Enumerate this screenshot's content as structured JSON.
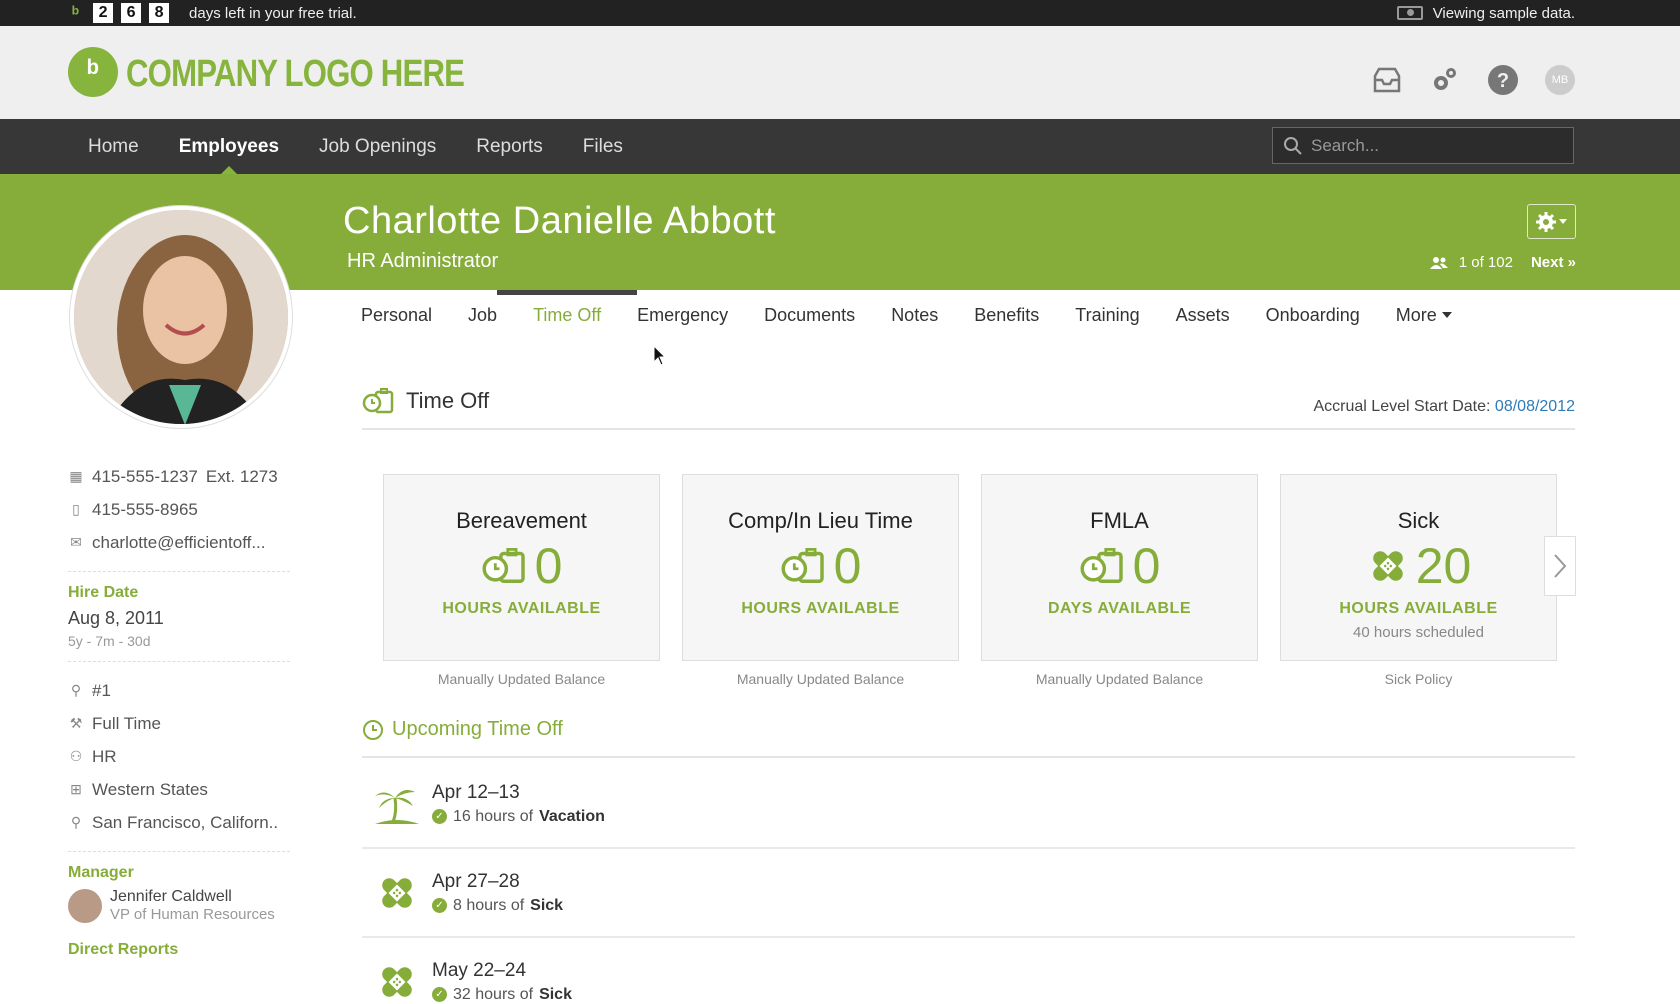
{
  "trial": {
    "digits": [
      "2",
      "6",
      "8"
    ],
    "text": "days left in your free trial.",
    "sample_text": "Viewing sample data."
  },
  "header": {
    "logo_text": "COMPANY LOGO HERE",
    "avatar_initials": "MB"
  },
  "nav": {
    "items": [
      {
        "label": "Home"
      },
      {
        "label": "Employees"
      },
      {
        "label": "Job Openings"
      },
      {
        "label": "Reports"
      },
      {
        "label": "Files"
      }
    ],
    "active": "Employees",
    "search_placeholder": "Search..."
  },
  "employee": {
    "name": "Charlotte Danielle Abbott",
    "title": "HR Administrator",
    "pager": "1 of 102",
    "next": "Next »",
    "work_phone": "415-555-1237",
    "work_ext": "Ext. 1273",
    "mobile": "415-555-8965",
    "email": "charlotte@efficientoff...",
    "hire_date_label": "Hire Date",
    "hire_date": "Aug 8, 2011",
    "tenure": "5y - 7m - 30d",
    "employee_number": "#1",
    "employment_type": "Full Time",
    "department": "HR",
    "division": "Western States",
    "location": "San Francisco, Californ..",
    "manager_label": "Manager",
    "manager_name": "Jennifer Caldwell",
    "manager_title": "VP of Human Resources",
    "direct_reports_label": "Direct Reports"
  },
  "tabs": [
    {
      "label": "Personal"
    },
    {
      "label": "Job"
    },
    {
      "label": "Time Off"
    },
    {
      "label": "Emergency"
    },
    {
      "label": "Documents"
    },
    {
      "label": "Notes"
    },
    {
      "label": "Benefits"
    },
    {
      "label": "Training"
    },
    {
      "label": "Assets"
    },
    {
      "label": "Onboarding"
    },
    {
      "label": "More"
    }
  ],
  "active_tab": "Time Off",
  "time_off": {
    "title": "Time Off",
    "accrual_label": "Accrual Level Start Date:",
    "accrual_date": "08/08/2012",
    "cards": [
      {
        "title": "Bereavement",
        "value": "0",
        "unit": "HOURS AVAILABLE",
        "scheduled": "",
        "footer": "Manually Updated Balance",
        "icon": "clock-suitcase-icon"
      },
      {
        "title": "Comp/In Lieu Time",
        "value": "0",
        "unit": "HOURS AVAILABLE",
        "scheduled": "",
        "footer": "Manually Updated Balance",
        "icon": "clock-suitcase-icon"
      },
      {
        "title": "FMLA",
        "value": "0",
        "unit": "DAYS AVAILABLE",
        "scheduled": "",
        "footer": "Manually Updated Balance",
        "icon": "clock-suitcase-icon"
      },
      {
        "title": "Sick",
        "value": "20",
        "unit": "HOURS AVAILABLE",
        "scheduled": "40 hours scheduled",
        "footer": "Sick Policy",
        "icon": "bandage-icon"
      }
    ],
    "upcoming_title": "Upcoming Time Off",
    "upcoming": [
      {
        "date": "Apr 12–13",
        "hours": "16 hours of",
        "type": "Vacation",
        "icon": "palm-tree-icon"
      },
      {
        "date": "Apr 27–28",
        "hours": "8 hours of",
        "type": "Sick",
        "icon": "bandage-icon"
      },
      {
        "date": "May 22–24",
        "hours": "32 hours of",
        "type": "Sick",
        "icon": "bandage-icon"
      }
    ]
  },
  "colors": {
    "brand_green": "#86ad3a",
    "nav_dark": "#373737",
    "link_blue": "#2f7bb6"
  }
}
